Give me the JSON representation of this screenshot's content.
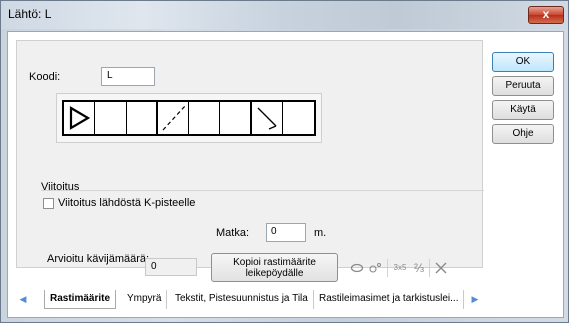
{
  "window": {
    "title": "Lähtö: L",
    "close_label": "x"
  },
  "form": {
    "code_label": "Koodi:",
    "code_value": "L",
    "symbol_cells": [
      "start-triangle",
      "empty",
      "empty",
      "dashed-diagonal",
      "empty",
      "empty",
      "corner-line",
      "empty"
    ],
    "marking_group_title": "Viitoitus",
    "marking_checkbox_label": "Viitoitus lähdöstä K-pisteelle",
    "marking_checked": false,
    "distance_label": "Matka:",
    "distance_value": "0",
    "distance_unit": "m.",
    "estimate_label": "Arvioitu kävijämäärä:",
    "estimate_value": "0",
    "copy_button_line1": "Kopioi rastimäärite",
    "copy_button_line2": "leikepöydälle"
  },
  "toolbar": {
    "icons": [
      "ellipse-icon",
      "small-circles-icon",
      "grid-3x5-icon",
      "fraction-icon",
      "delete-x-icon"
    ],
    "grid_label": "3x5",
    "fraction_label": "⅔"
  },
  "buttons": {
    "ok": "OK",
    "cancel": "Peruuta",
    "apply": "Käytä",
    "help": "Ohje"
  },
  "tabs": [
    {
      "label": "Rastimäärite",
      "active": true
    },
    {
      "label": "Ympyrä",
      "active": false
    },
    {
      "label": "Tekstit, Pistesuunnistus ja Tila",
      "active": false
    },
    {
      "label": "Rastileimasimet ja tarkistuslei...",
      "active": false
    }
  ]
}
